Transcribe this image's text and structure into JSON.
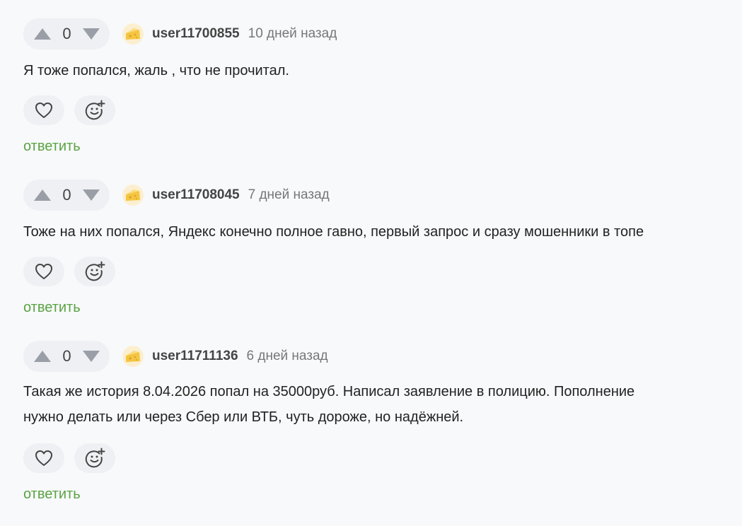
{
  "comments": [
    {
      "score": "0",
      "username": "user11700855",
      "date": "10 дней назад",
      "text_lines": [
        "Я тоже попался, жаль , что не прочитал."
      ],
      "reply_label": "ответить"
    },
    {
      "score": "0",
      "username": "user11708045",
      "date": "7 дней назад",
      "text_lines": [
        "Тоже на них попался, Яндекс конечно полное гавно, первый запрос и сразу мошенники в топе"
      ],
      "reply_label": "ответить"
    },
    {
      "score": "0",
      "username": "user11711136",
      "date": "6 дней назад",
      "text_lines": [
        "Такая же история 8.04.2026 попал на 35000руб. Написал заявление в полицию. Пополнение",
        "нужно делать или через Сбер или ВТБ, чуть дороже, но надёжней."
      ],
      "reply_label": "ответить"
    }
  ],
  "icons": {
    "upvote": "upvote-icon",
    "downvote": "downvote-icon",
    "avatar": "cheese-avatar-icon",
    "like": "heart-icon",
    "reaction": "add-emoji-icon"
  },
  "colors": {
    "background": "#f8f9fb",
    "pill": "#eef0f3",
    "reply": "#5aa343",
    "arrow": "#9a9ea6"
  }
}
